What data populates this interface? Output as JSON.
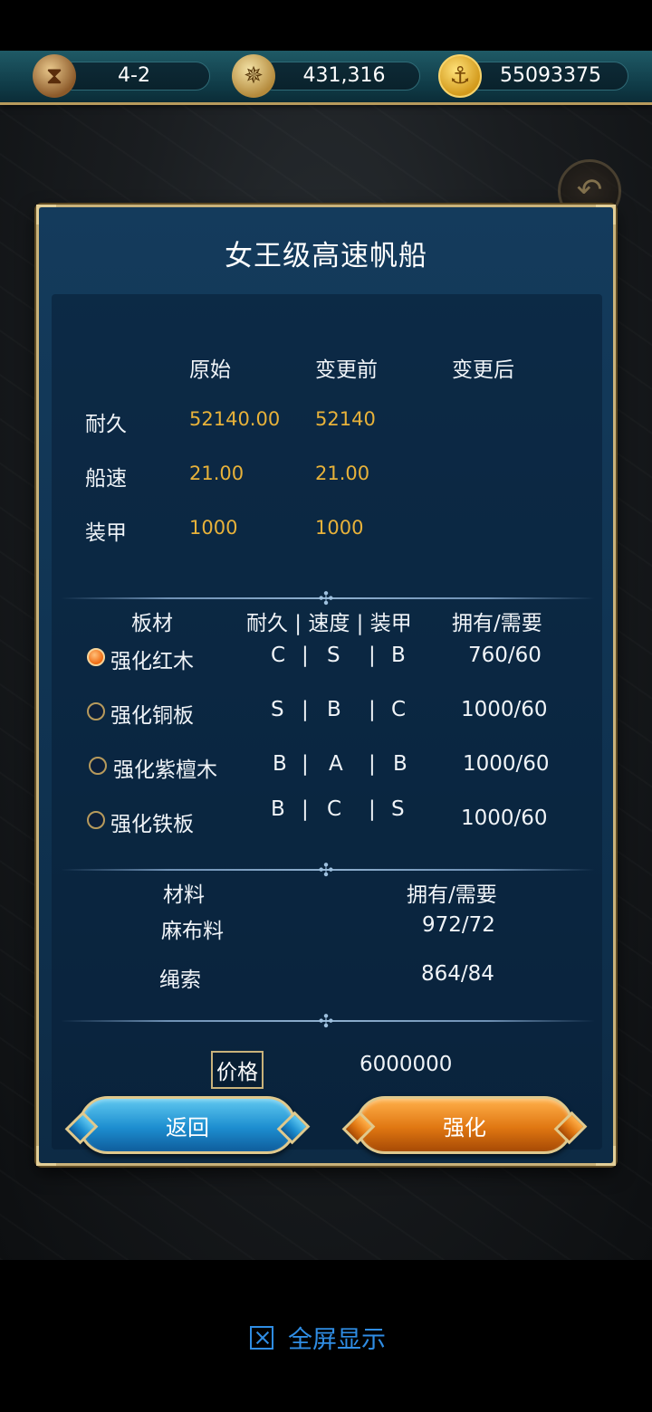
{
  "resources": {
    "level": "4-2",
    "compass_value": "431,316",
    "gold_value": "55093375",
    "hourglass_icon": "hourglass-icon",
    "compass_icon": "compass-icon",
    "gold_icon": "anchor-coin-icon"
  },
  "dialog": {
    "title": "女王级高速帆船",
    "stats": {
      "headers": [
        "原始",
        "变更前",
        "变更后"
      ],
      "rows": [
        {
          "label": "耐久",
          "original": "52140.00",
          "before": "52140",
          "after": ""
        },
        {
          "label": "船速",
          "original": "21.00",
          "before": "21.00",
          "after": ""
        },
        {
          "label": "装甲",
          "original": "1000",
          "before": "1000",
          "after": ""
        }
      ]
    },
    "boards": {
      "headers": {
        "name": "板材",
        "attrs": "耐久 | 速度 | 装甲",
        "own_need": "拥有/需要"
      },
      "rows": [
        {
          "name": "强化红木",
          "dur": "C",
          "spd": "S",
          "arm": "B",
          "own_need": "760/60",
          "selected": true
        },
        {
          "name": "强化铜板",
          "dur": "S",
          "spd": "B",
          "arm": "C",
          "own_need": "1000/60",
          "selected": false
        },
        {
          "name": "强化紫檀木",
          "dur": "B",
          "spd": "A",
          "arm": "B",
          "own_need": "1000/60",
          "selected": false
        },
        {
          "name": "强化铁板",
          "dur": "B",
          "spd": "C",
          "arm": "S",
          "own_need": "1000/60",
          "selected": false
        }
      ],
      "sep": "|"
    },
    "materials": {
      "headers": {
        "name": "材料",
        "own_need": "拥有/需要"
      },
      "rows": [
        {
          "name": "麻布料",
          "own_need": "972/72"
        },
        {
          "name": "绳索",
          "own_need": "864/84"
        }
      ]
    },
    "price": {
      "label": "价格",
      "value": "6000000"
    },
    "buttons": {
      "back": "返回",
      "enhance": "强化"
    }
  },
  "footer": {
    "fullscreen_label": "全屏显示"
  },
  "colors": {
    "value_gold": "#e8b23a",
    "panel_blue": "#143b5c",
    "frame_gold": "#c9b27a",
    "link_blue": "#2f8de4"
  }
}
